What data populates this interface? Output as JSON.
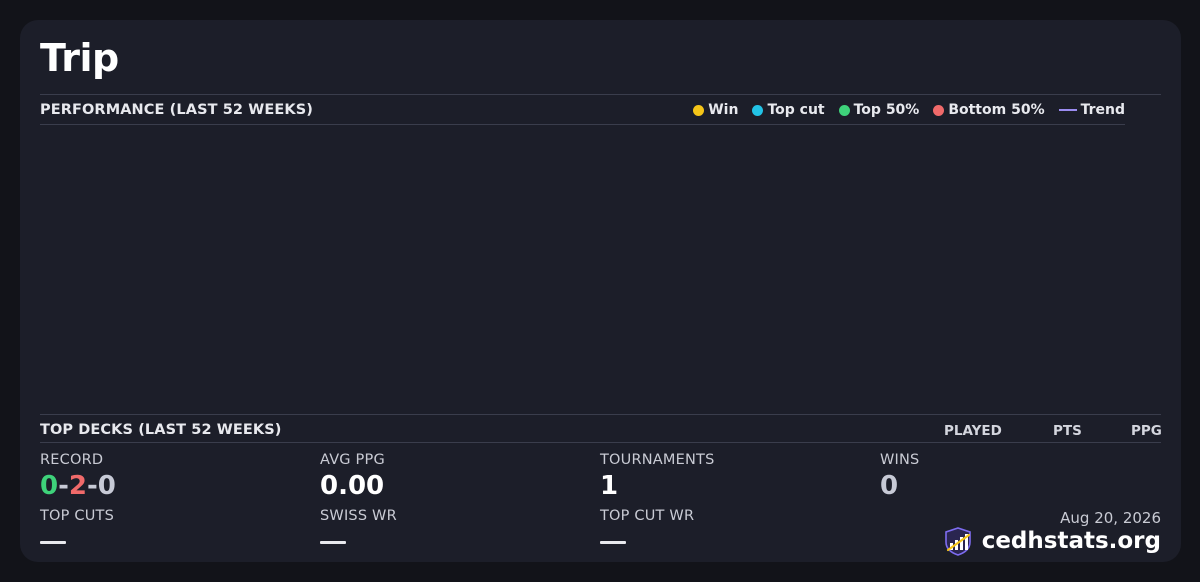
{
  "player": {
    "name": "Trip"
  },
  "performance": {
    "heading": "PERFORMANCE (LAST 52 WEEKS)",
    "legend": [
      {
        "label": "Win",
        "color": "#f5c518",
        "marker": "dot"
      },
      {
        "label": "Top cut",
        "color": "#22c3e6",
        "marker": "dot"
      },
      {
        "label": "Top 50%",
        "color": "#3ed27a",
        "marker": "dot"
      },
      {
        "label": "Bottom 50%",
        "color": "#f06a6a",
        "marker": "dot"
      },
      {
        "label": "Trend",
        "color": "#9b8cf0",
        "marker": "line"
      }
    ]
  },
  "top_decks": {
    "heading": "TOP DECKS (LAST 52 WEEKS)",
    "columns": [
      "PLAYED",
      "PTS",
      "PPG"
    ]
  },
  "stats": {
    "record": {
      "label": "RECORD",
      "wins": "0",
      "losses": "2",
      "draws": "0",
      "sep": "-"
    },
    "avg_ppg": {
      "label": "AVG PPG",
      "value": "0.00"
    },
    "tournaments": {
      "label": "TOURNAMENTS",
      "value": "1"
    },
    "wins": {
      "label": "WINS",
      "value": "0"
    },
    "top_cuts": {
      "label": "TOP CUTS",
      "value": "—"
    },
    "swiss_wr": {
      "label": "SWISS WR",
      "value": "—"
    },
    "top_cut_wr": {
      "label": "TOP CUT WR",
      "value": "—"
    }
  },
  "footer": {
    "date": "Aug 20, 2026",
    "brand": "cedhstats.org",
    "logo_icon": "chart-shield-icon"
  },
  "colors": {
    "win_green": "#3ed27a",
    "loss_red": "#f06a6a",
    "draw_gray": "#c7cad6",
    "muted_value": "#c7cad6"
  }
}
